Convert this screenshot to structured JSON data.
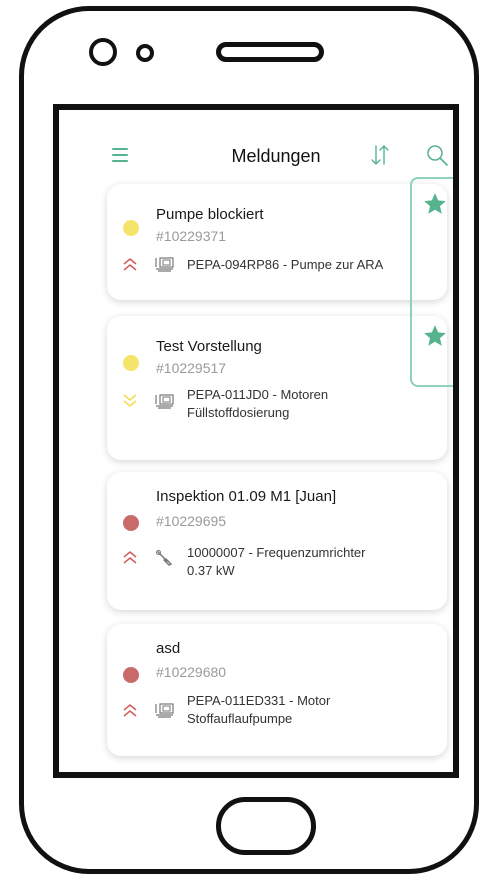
{
  "app": {
    "title": "Meldungen"
  },
  "icons": {
    "menu": "hamburger-menu-icon",
    "sort": "sort-arrows-icon",
    "search": "search-icon",
    "favorite": "star-icon",
    "priority_high": "double-chevron-up-icon",
    "priority_low": "double-chevron-down-icon",
    "asset_machine": "machine-icon",
    "asset_tool": "wrench-icon"
  },
  "colors": {
    "accent": "#57b38e",
    "status_yellow": "#f5e46a",
    "status_red": "#c96b6b",
    "priority_high": "#d15b5b",
    "priority_low": "#f2dc50"
  },
  "notifications": [
    {
      "name": "Pumpe blockiert",
      "number": "#10229371",
      "status": "yellow",
      "priority": "high",
      "asset_type": "machine",
      "asset_lines": [
        "PEPA-094RP86 - Pumpe zur ARA"
      ],
      "favorite": true
    },
    {
      "name": "Test Vorstellung",
      "number": "#10229517",
      "status": "yellow",
      "priority": "low",
      "asset_type": "machine",
      "asset_lines": [
        "PEPA-011JD0 - Motoren",
        "Füllstoffdosierung"
      ],
      "favorite": true
    },
    {
      "name": "Inspektion 01.09 M1 [Juan]",
      "number": "#10229695",
      "status": "red",
      "priority": "high",
      "asset_type": "tool",
      "asset_lines": [
        "10000007 - Frequenzumrichter",
        "0.37 kW"
      ],
      "favorite": false
    },
    {
      "name": "asd",
      "number": "#10229680",
      "status": "red",
      "priority": "high",
      "asset_type": "machine",
      "asset_lines": [
        "PEPA-011ED331 - Motor",
        "Stoffauflaufpumpe"
      ],
      "favorite": false
    }
  ]
}
